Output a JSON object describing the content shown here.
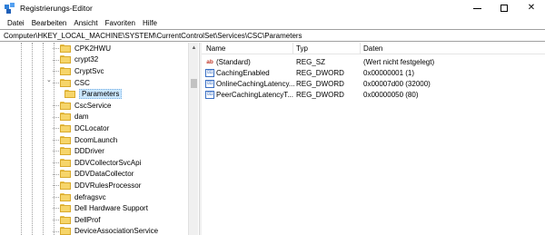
{
  "window": {
    "title": "Registrierungs-Editor"
  },
  "menu": [
    "Datei",
    "Bearbeiten",
    "Ansicht",
    "Favoriten",
    "Hilfe"
  ],
  "address": "Computer\\HKEY_LOCAL_MACHINE\\SYSTEM\\CurrentControlSet\\Services\\CSC\\Parameters",
  "tree": {
    "items": [
      {
        "label": "CPK2HWU"
      },
      {
        "label": "crypt32"
      },
      {
        "label": "CryptSvc"
      },
      {
        "label": "CSC",
        "expanded": true
      },
      {
        "label": "Parameters",
        "selected": true,
        "child": true
      },
      {
        "label": "CscService"
      },
      {
        "label": "dam"
      },
      {
        "label": "DCLocator"
      },
      {
        "label": "DcomLaunch"
      },
      {
        "label": "DDDriver"
      },
      {
        "label": "DDVCollectorSvcApi"
      },
      {
        "label": "DDVDataCollector"
      },
      {
        "label": "DDVRulesProcessor"
      },
      {
        "label": "defragsvc"
      },
      {
        "label": "Dell Hardware Support"
      },
      {
        "label": "DellProf"
      },
      {
        "label": "DeviceAssociationService"
      }
    ],
    "expander_symbol": "⌄"
  },
  "list": {
    "columns": {
      "name": "Name",
      "type": "Typ",
      "data": "Daten"
    },
    "rows": [
      {
        "icon": "string-value-icon",
        "name": "(Standard)",
        "type": "REG_SZ",
        "data": "(Wert nicht festgelegt)"
      },
      {
        "icon": "dword-value-icon",
        "name": "CachingEnabled",
        "type": "REG_DWORD",
        "data": "0x00000001 (1)"
      },
      {
        "icon": "dword-value-icon",
        "name": "OnlineCachingLatency...",
        "type": "REG_DWORD",
        "data": "0x00007d00 (32000)"
      },
      {
        "icon": "dword-value-icon",
        "name": "PeerCachingLatencyT...",
        "type": "REG_DWORD",
        "data": "0x00000050 (80)"
      }
    ]
  },
  "colors": {
    "selection": "#cce8ff",
    "folder": "#f6d56a",
    "string_icon": "#c0392b",
    "dword_icon": "#3a6fc4"
  }
}
